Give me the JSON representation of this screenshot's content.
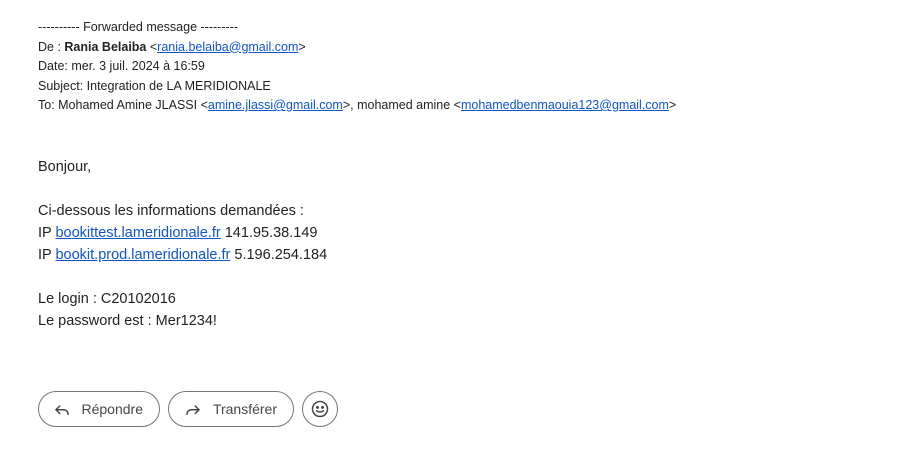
{
  "forwarded_header": {
    "separator": "---------- Forwarded message ---------",
    "from_label": "De : ",
    "from_name": "Rania Belaiba",
    "from_email": "rania.belaiba@gmail.com",
    "date_line": "Date: mer. 3 juil. 2024 à 16:59",
    "subject_line": "Subject: Integration de LA MERIDIONALE",
    "to_label": "To: Mohamed Amine JLASSI <",
    "to_email_1": "amine.jlassi@gmail.com",
    "to_middle": ">, mohamed amine <",
    "to_email_2": "mohamedbenmaouia123@gmail.com",
    "to_end": ">"
  },
  "body": {
    "greeting": "Bonjour,",
    "intro": "Ci-dessous les informations demandées :",
    "ip_prefix": "IP ",
    "ip1_host": "bookittest.lameridionale.fr",
    "ip1_addr": " 141.95.38.149",
    "ip2_host": "bookit.prod.lameridionale.fr",
    "ip2_addr": " 5.196.254.184",
    "login_line": "Le login : C20102016",
    "password_line": "Le password est : Mer1234!"
  },
  "actions": {
    "reply_label": "Répondre",
    "forward_label": "Transférer",
    "reply_icon": "reply-arrow-icon",
    "forward_icon": "forward-arrow-icon",
    "emoji_icon": "emoji-smile-icon"
  },
  "colors": {
    "link": "#1155cc",
    "text": "#222222",
    "button_border": "#747775",
    "button_text": "#444746"
  }
}
